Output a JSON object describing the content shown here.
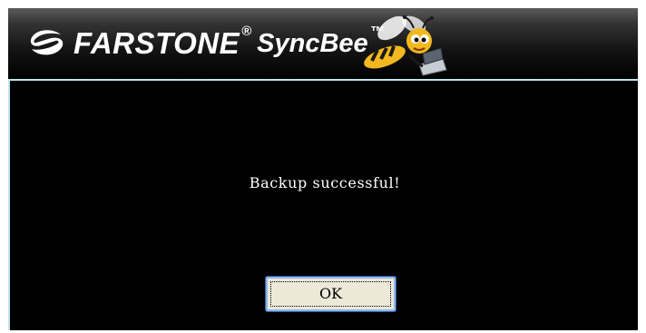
{
  "window": {
    "brand": {
      "company": "FARSTONE",
      "registered_mark": "®",
      "product": "SyncBee",
      "trademark": "™"
    },
    "logo_icon": "farstone-swoosh-icon",
    "mascot": "bee-with-laptop-mascot"
  },
  "dialog": {
    "message": "Backup successful!",
    "ok_label": "OK"
  },
  "colors": {
    "background": "#000000",
    "accent_border": "#bfe4ee",
    "button_face": "#ece9d8",
    "button_border": "#2a5fa8",
    "bee_yellow": "#f2b81f"
  }
}
